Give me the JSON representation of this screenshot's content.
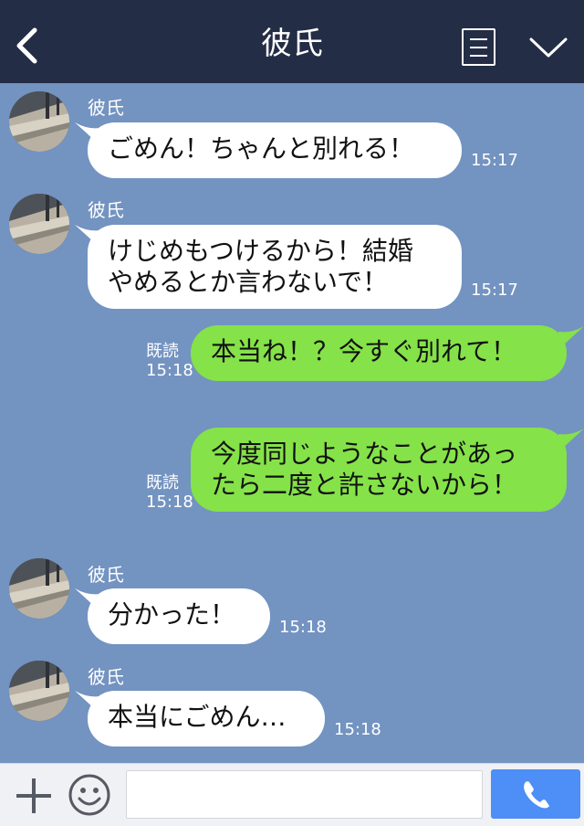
{
  "header": {
    "title": "彼氏",
    "back_icon": "chevron-left-icon",
    "menu_icon": "menu-icon",
    "dropdown_icon": "chevron-down-icon"
  },
  "messages": [
    {
      "sender": "彼氏",
      "text": "ごめん！ちゃんと別れる！",
      "time": "15:17",
      "direction": "in"
    },
    {
      "sender": "彼氏",
      "text": "けじめもつけるから！結婚\nやめるとか言わないで！",
      "time": "15:17",
      "direction": "in"
    },
    {
      "text": "本当ね！？今すぐ別れて！",
      "time": "15:18",
      "read": "既読",
      "direction": "out"
    },
    {
      "text": "今度同じようなことがあっ\nたら二度と許さないから！",
      "time": "15:18",
      "read": "既読",
      "direction": "out"
    },
    {
      "sender": "彼氏",
      "text": "分かった！",
      "time": "15:18",
      "direction": "in"
    },
    {
      "sender": "彼氏",
      "text": "本当にごめん…",
      "time": "15:18",
      "direction": "in"
    }
  ],
  "bottom_bar": {
    "plus_icon": "plus-icon",
    "emoji_icon": "smiley-icon",
    "input_value": "",
    "call_icon": "phone-icon"
  },
  "colors": {
    "header_bg": "#232d45",
    "chat_bg": "#7393c1",
    "incoming_bubble": "#ffffff",
    "outgoing_bubble": "#85e249",
    "call_button": "#4d8ef7"
  }
}
